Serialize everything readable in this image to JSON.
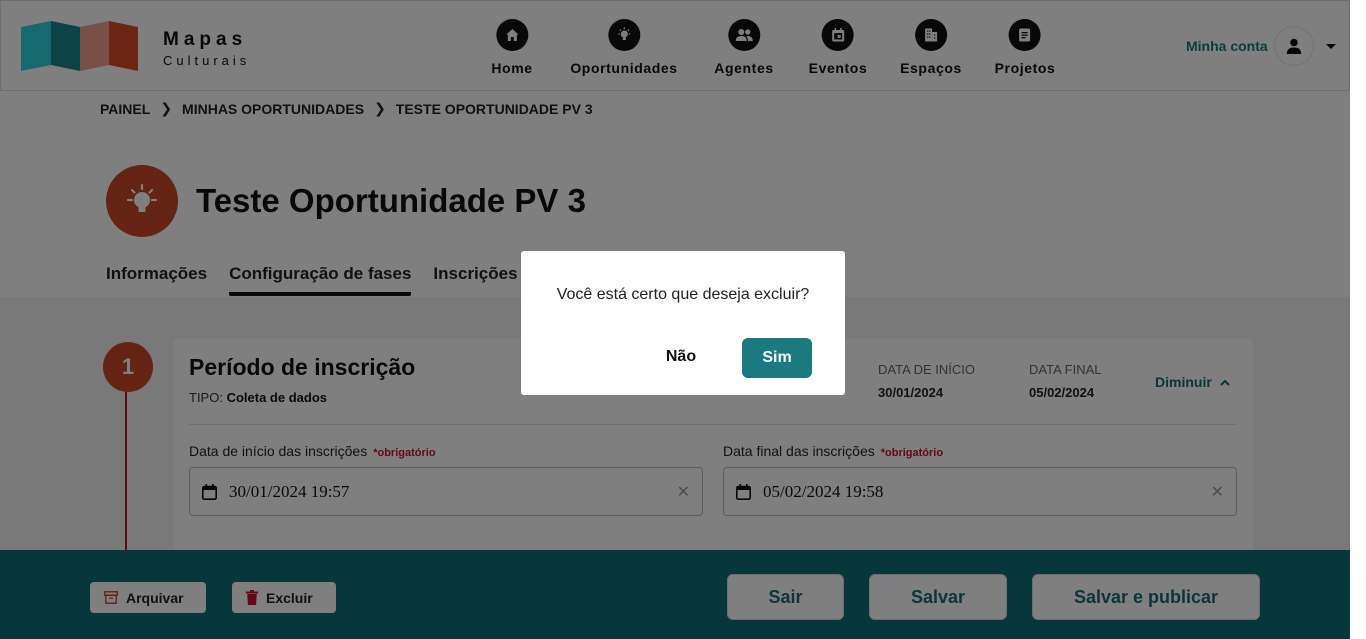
{
  "brand": {
    "title": "Mapas",
    "subtitle": "Culturais"
  },
  "nav": [
    {
      "label": "Home",
      "icon": "home-icon"
    },
    {
      "label": "Oportunidades",
      "icon": "lightbulb-icon"
    },
    {
      "label": "Agentes",
      "icon": "people-icon"
    },
    {
      "label": "Eventos",
      "icon": "calendar-icon"
    },
    {
      "label": "Espaços",
      "icon": "building-icon"
    },
    {
      "label": "Projetos",
      "icon": "document-icon"
    }
  ],
  "account": {
    "label": "Minha conta",
    "icon": "user-icon"
  },
  "breadcrumb": [
    "PAINEL",
    "MINHAS OPORTUNIDADES",
    "TESTE OPORTUNIDADE PV 3"
  ],
  "page": {
    "title": "Teste Oportunidade PV 3",
    "tabs": [
      "Informações",
      "Configuração de fases",
      "Inscrições e R"
    ],
    "active_tab": "Configuração de fases"
  },
  "phase": {
    "number": "1",
    "title": "Período de inscrição",
    "type_label": "TIPO:",
    "type_value": "Coleta de dados",
    "start_label": "DATA DE INÍCIO",
    "start_value": "30/01/2024",
    "end_label": "DATA FINAL",
    "end_value": "05/02/2024",
    "collapse_label": "Diminuir",
    "fields": [
      {
        "label": "Data de início das inscrições",
        "required": "*obrigatório",
        "value": "30/01/2024 19:57"
      },
      {
        "label": "Data final das inscrições",
        "required": "*obrigatório",
        "value": "05/02/2024 19:58"
      }
    ]
  },
  "footer": {
    "archive": "Arquivar",
    "delete": "Excluir",
    "exit": "Sair",
    "save": "Salvar",
    "save_publish": "Salvar e publicar"
  },
  "modal": {
    "message": "Você está certo que deseja excluir?",
    "no": "Não",
    "yes": "Sim"
  },
  "colors": {
    "accent": "#1a7a80",
    "brand_red": "#c84627",
    "footer_bg": "#0f6e75",
    "required": "#c8102e"
  }
}
